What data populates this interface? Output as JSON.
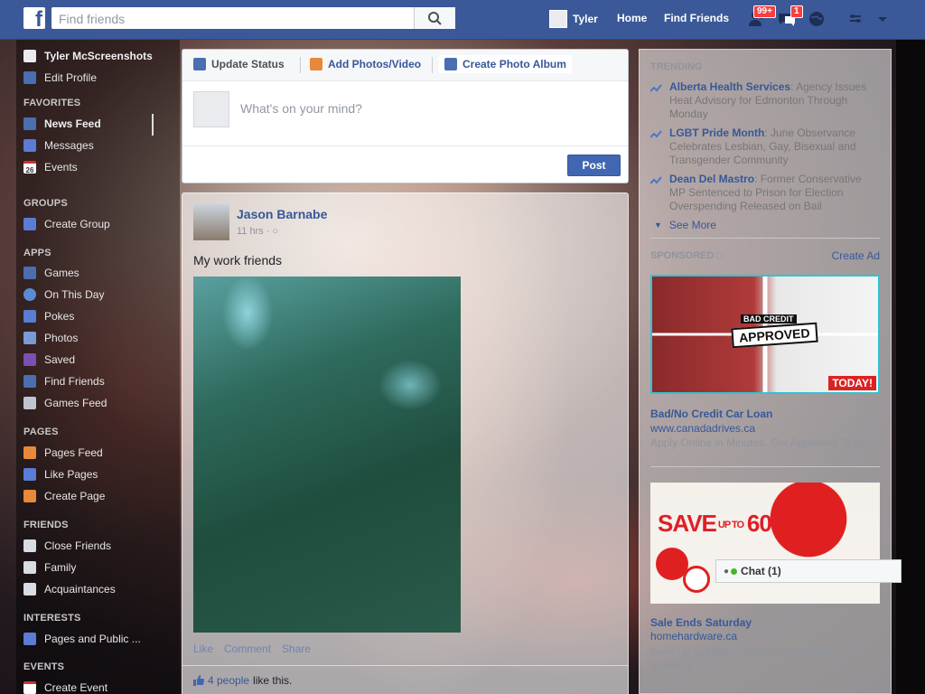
{
  "topbar": {
    "search_placeholder": "Find friends",
    "user_name": "Tyler",
    "home_label": "Home",
    "find_friends_label": "Find Friends",
    "friend_requests_badge": "99+",
    "messages_badge": "1"
  },
  "left": {
    "profile_name": "Tyler McScreenshots",
    "edit_profile": "Edit Profile",
    "favorites_head": "FAVORITES",
    "news_feed": "News Feed",
    "messages": "Messages",
    "events": "Events",
    "events_icon_day": "26",
    "groups_head": "GROUPS",
    "create_group": "Create Group",
    "apps_head": "APPS",
    "games": "Games",
    "on_this_day": "On This Day",
    "pokes": "Pokes",
    "photos": "Photos",
    "saved": "Saved",
    "find_friends": "Find Friends",
    "games_feed": "Games Feed",
    "pages_head": "PAGES",
    "pages_feed": "Pages Feed",
    "like_pages": "Like Pages",
    "create_page": "Create Page",
    "friends_head": "FRIENDS",
    "close_friends": "Close Friends",
    "family": "Family",
    "acquaintances": "Acquaintances",
    "interests_head": "INTERESTS",
    "pages_public": "Pages and Public ...",
    "events_head": "EVENTS",
    "create_event": "Create Event"
  },
  "composer": {
    "tab_status": "Update Status",
    "tab_photos": "Add Photos/Video",
    "tab_album": "Create Photo Album",
    "placeholder": "What's on your mind?",
    "post": "Post"
  },
  "story": {
    "author": "Jason Barnabe",
    "time": "11 hrs",
    "text": "My work friends",
    "like": "Like",
    "comment": "Comment",
    "share": "Share",
    "likes_count": "4 people",
    "likes_suffix": "like this."
  },
  "right": {
    "trending_head": "TRENDING",
    "trends": [
      {
        "title": "Alberta Health Services",
        "desc": ": Agency Issues Heat Advisory for Edmonton Through Monday"
      },
      {
        "title": "LGBT Pride Month",
        "desc": ": June Observance Celebrates Lesbian, Gay, Bisexual and Transgender Community"
      },
      {
        "title": "Dean Del Mastro",
        "desc": ": Former Conservative MP Sentenced to Prison for Election Overspending Released on Bail"
      }
    ],
    "see_more": "See More",
    "sponsored_head": "SPONSORED",
    "create_ad": "Create Ad",
    "ad1_badge_top": "BAD CREDIT",
    "ad1_badge": "APPROVED",
    "ad1_corner": "TODAY!",
    "ad1_title": "Bad/No Credit Car Loan",
    "ad1_url": "www.canadadrives.ca",
    "ad1_desc": "Apply Online in Minutes. Get Approved Today!",
    "ad2_save": "SAVE",
    "ad2_upto": "UP TO",
    "ad2_pct": "60%",
    "ad2_title": "Sale Ends Saturday",
    "ad2_url": "homehardware.ca",
    "ad2_desc": "Save up to 60% on select Canada Day products."
  },
  "chat": {
    "label": "Chat (1)"
  }
}
